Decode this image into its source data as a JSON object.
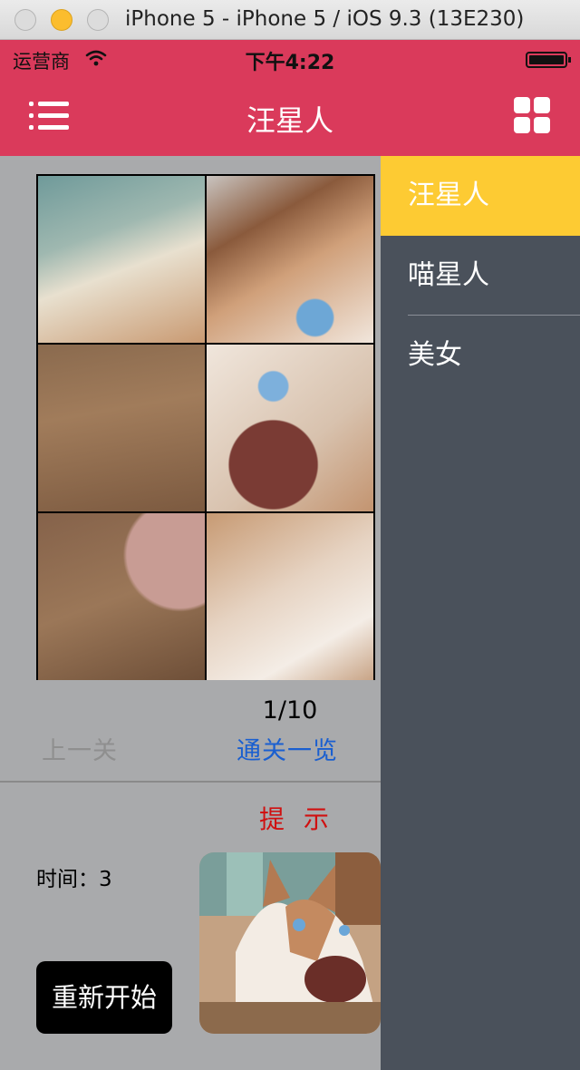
{
  "window": {
    "title": "iPhone 5 - iPhone 5 / iOS 9.3 (13E230)"
  },
  "status_bar": {
    "carrier": "运营商",
    "time": "下午4:22"
  },
  "nav_bar": {
    "title": "汪星人"
  },
  "game": {
    "level": "1/10",
    "prev_level_label": "上一关",
    "overview_label": "通关一览",
    "hint_label": "提 示",
    "timer_label": "时间：3",
    "restart_label": "重新开始"
  },
  "drawer": {
    "items": [
      {
        "label": "汪星人",
        "selected": true
      },
      {
        "label": "喵星人",
        "selected": false
      },
      {
        "label": "美女",
        "selected": false
      }
    ]
  },
  "colors": {
    "accent": "#da3a5b",
    "drawer_bg": "#4a515b",
    "drawer_selected": "#fdcb33",
    "link": "#1a5fd0",
    "hint": "#d01010"
  }
}
